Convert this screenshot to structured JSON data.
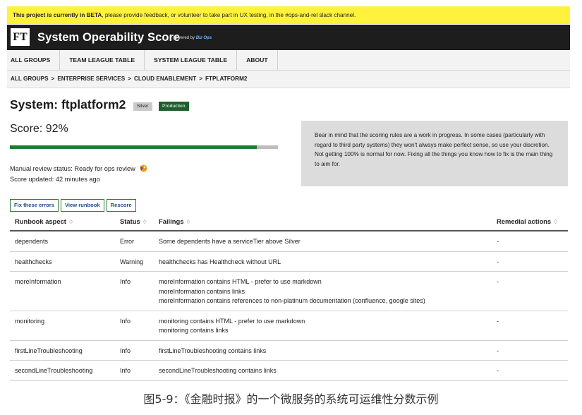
{
  "beta_banner": {
    "bold": "This project is currently in BETA",
    "rest": ", please provide feedback, or volunteer to take part in UX testing, in the #ops-and-rel slack channel."
  },
  "header": {
    "logo": "FT",
    "title": "System Operability Score",
    "powered_by": "powered by",
    "powered_brand": "Biz Ops"
  },
  "nav": [
    "ALL GROUPS",
    "TEAM LEAGUE TABLE",
    "SYSTEM LEAGUE TABLE",
    "ABOUT"
  ],
  "breadcrumb": [
    "ALL GROUPS",
    "ENTERPRISE SERVICES",
    "CLOUD ENABLEMENT",
    "FTPLATFORM2"
  ],
  "breadcrumb_separator": ">",
  "system": {
    "title": "System: ftplatform2",
    "tier_badge": "Silver",
    "env_badge": "Production"
  },
  "score": {
    "label": "Score: 92%",
    "progress_fraction": 0.92,
    "review_status": "Manual review status: Ready for ops review",
    "updated": "Score updated: 42 minutes ago"
  },
  "note": "Bear in mind that the scoring rules are a work in progress. In some cases (particularly with regard to third party systems) they won't always make perfect sense, so use your discretion. Not getting 100% is normal for now. Fixing all the things you know how to fix is the main thing to aim for.",
  "buttons": [
    "Fix these errors",
    "View runbook",
    "Rescore"
  ],
  "table": {
    "headers": [
      "Runbook aspect",
      "Status",
      "Failings",
      "Remedial actions"
    ],
    "sort_glyph": "♢",
    "rows": [
      {
        "aspect": "dependents",
        "status": "Error",
        "failings": [
          "Some dependents have a serviceTier above Silver"
        ],
        "action": "-"
      },
      {
        "aspect": "healthchecks",
        "status": "Warning",
        "failings": [
          "healthchecks has Healthcheck without URL"
        ],
        "action": "-"
      },
      {
        "aspect": "moreInformation",
        "status": "Info",
        "failings": [
          "moreInformation contains HTML - prefer to use markdown",
          "moreInformation contains links",
          "moreInformation contains references to non-platinum documentation (confluence, google sites)"
        ],
        "action": "-"
      },
      {
        "aspect": "monitoring",
        "status": "Info",
        "failings": [
          "monitoring contains HTML - prefer to use markdown",
          "monitoring contains links"
        ],
        "action": "-"
      },
      {
        "aspect": "firstLineTroubleshooting",
        "status": "Info",
        "failings": [
          "firstLineTroubleshooting contains links"
        ],
        "action": "-"
      },
      {
        "aspect": "secondLineTroubleshooting",
        "status": "Info",
        "failings": [
          "secondLineTroubleshooting contains links"
        ],
        "action": "-"
      }
    ]
  },
  "caption": "图5-9：《金融时报》的一个微服务的系统可运维性分数示例",
  "colors": {
    "beta_bg": "#fff23c",
    "header_bg": "#1d1d1d",
    "progress_fill": "#1e7d32",
    "production_badge": "#1f5f2e",
    "silver_badge": "#c9c9c9"
  }
}
